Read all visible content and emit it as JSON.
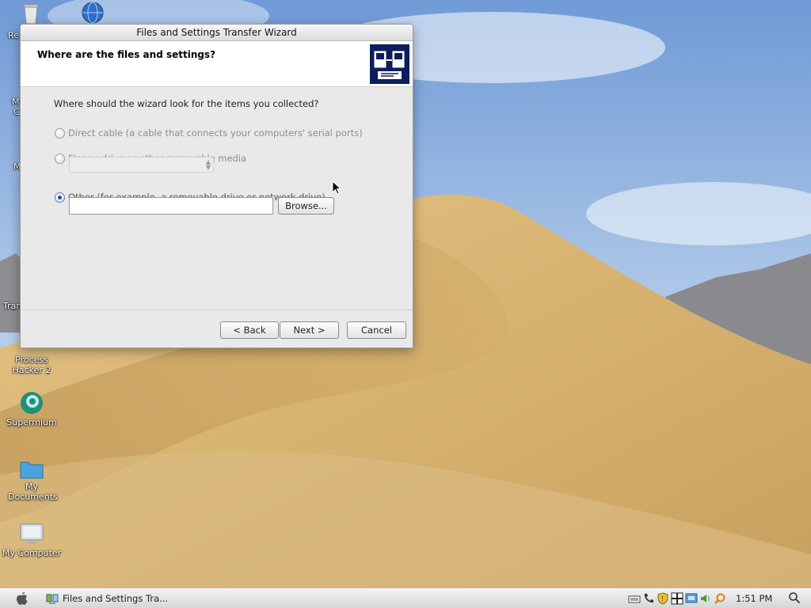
{
  "dialog": {
    "title": "Files and Settings Transfer Wizard",
    "header_title": "Where are the files and settings?",
    "question": "Where should the wizard look for the items you collected?",
    "options": [
      {
        "label": "Direct cable (a cable that connects your computers' serial ports)",
        "enabled": false,
        "checked": false
      },
      {
        "label": "Floppy drive or other removable media",
        "enabled": false,
        "checked": false
      },
      {
        "label": "Other (for example, a removable drive or network drive)",
        "enabled": true,
        "checked": true
      }
    ],
    "media_select_value": "",
    "path_value": "",
    "browse_label": "Browse...",
    "back_label": "< Back",
    "next_label": "Next >",
    "cancel_label": "Cancel"
  },
  "desktop": {
    "icons": [
      {
        "label": "Process Hacker 2",
        "icon": "process-hacker-icon"
      },
      {
        "label": "Supermium",
        "icon": "supermium-icon"
      },
      {
        "label": "My Documents",
        "icon": "folder-icon"
      },
      {
        "label": "My Computer",
        "icon": "computer-icon"
      }
    ],
    "edge_labels": [
      "Re",
      "M",
      "C",
      "M",
      "Tran"
    ]
  },
  "taskbar": {
    "task_label": "Files and Settings Tra...",
    "clock": "1:51 PM",
    "tray_icons": [
      "keyboard-icon",
      "phone-icon",
      "shield-icon",
      "grid-icon",
      "network-icon",
      "speaker-icon",
      "search-tray-icon"
    ]
  },
  "colors": {
    "sky": "#8fb3de",
    "sand": "#d9b77a",
    "dialog_bg": "#e9e9e9",
    "accent": "#1d4f9c"
  }
}
